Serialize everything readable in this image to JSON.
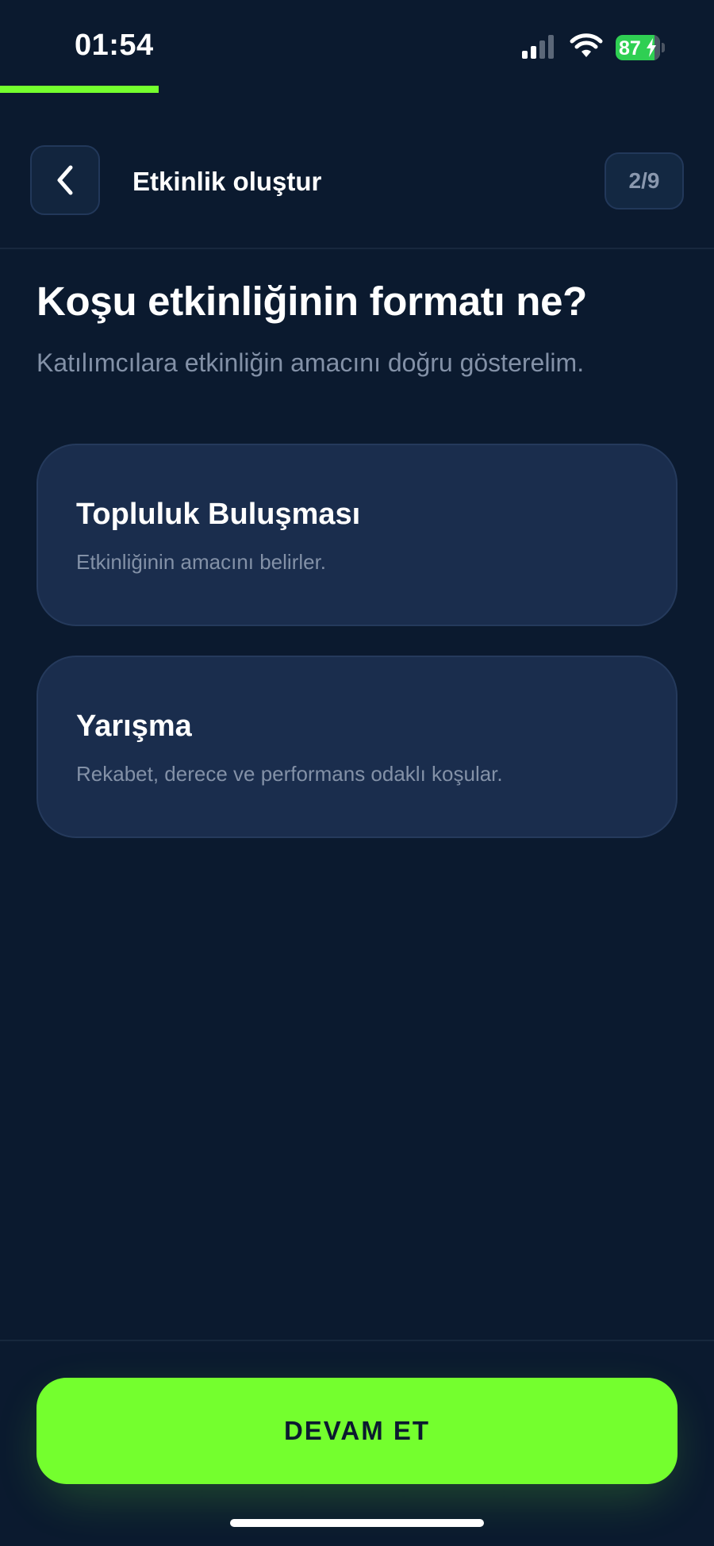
{
  "status_bar": {
    "time": "01:54",
    "battery_percent": "87",
    "signal_bars_active": 2,
    "signal_bars_total": 4
  },
  "progress": {
    "step": 2,
    "total": 9,
    "fraction": 0.222
  },
  "header": {
    "title": "Etkinlik oluştur",
    "step_label": "2/9"
  },
  "main": {
    "title": "Koşu etkinliğinin formatı ne?",
    "subtitle": "Katılımcılara etkinliğin amacını doğru gösterelim.",
    "options": [
      {
        "title": "Topluluk Buluşması",
        "description": "Etkinliğinin amacını belirler."
      },
      {
        "title": "Yarışma",
        "description": "Rekabet, derece ve performans odaklı koşular."
      }
    ]
  },
  "footer": {
    "continue_label": "DEVAM ET"
  },
  "colors": {
    "background": "#0b1a2f",
    "accent": "#74ff2e",
    "card": "#1a2d4d",
    "muted_text": "#8391a7",
    "battery": "#2fcf53"
  },
  "icons": {
    "back": "chevron-left-icon",
    "signal": "cellular-signal-icon",
    "wifi": "wifi-icon",
    "battery": "battery-charging-icon"
  }
}
